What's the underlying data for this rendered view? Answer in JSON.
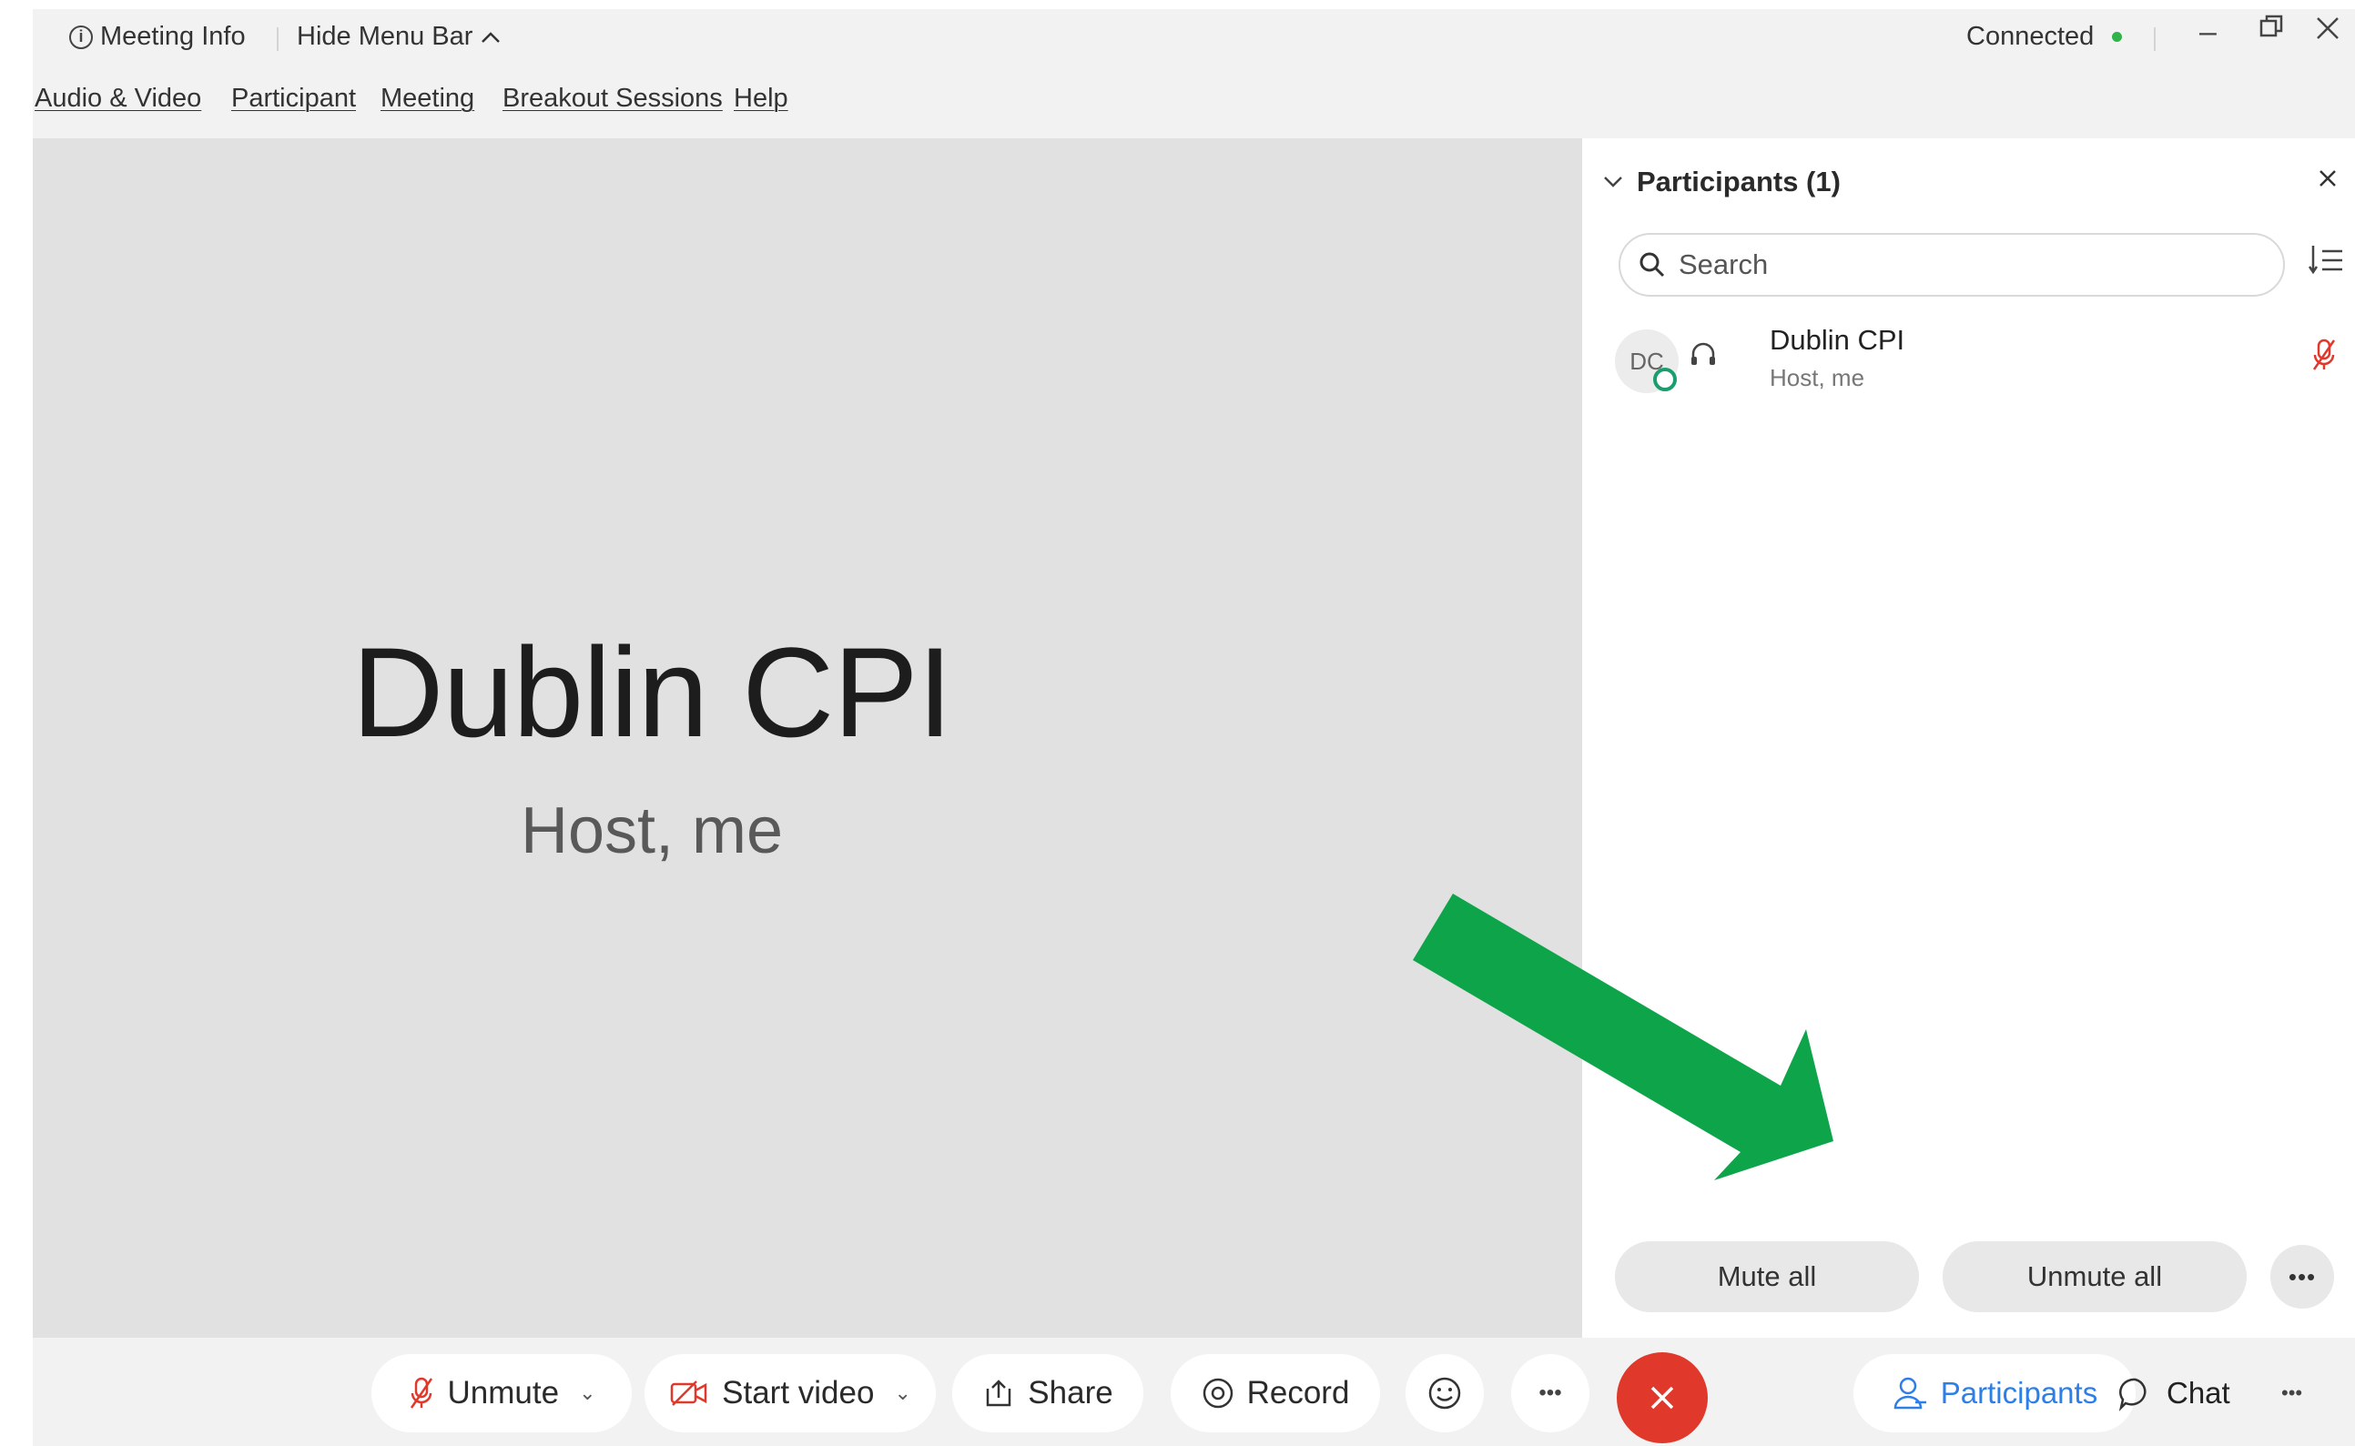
{
  "titlebar": {
    "meeting_info": "Meeting Info",
    "hide_menu_bar": "Hide Menu Bar",
    "status": "Connected",
    "status_color": "#2fb34a"
  },
  "menu": [
    "Audio & Video",
    "Participant",
    "Meeting",
    "Breakout Sessions",
    "Help"
  ],
  "stage": {
    "name": "Dublin CPI",
    "role": "Host, me"
  },
  "panel": {
    "title": "Participants (1)",
    "search_placeholder": "Search",
    "participants": [
      {
        "initials": "DC",
        "name": "Dublin CPI",
        "subtitle": "Host, me",
        "muted": true
      }
    ],
    "mute_all": "Mute all",
    "unmute_all": "Unmute all"
  },
  "toolbar": {
    "unmute": "Unmute",
    "start_video": "Start video",
    "share": "Share",
    "record": "Record",
    "participants": "Participants",
    "chat": "Chat"
  },
  "colors": {
    "accent": "#2d7ee6",
    "end_call": "#e0392b",
    "annotation_arrow": "#0ea54a",
    "muted_icon": "#e0392b"
  },
  "annotation": {
    "icon": "green-arrow-pointing-to-unmute-all"
  }
}
